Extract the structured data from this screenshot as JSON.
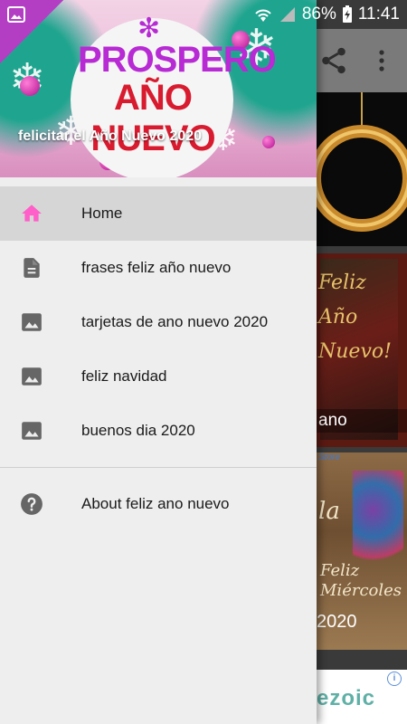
{
  "status_bar": {
    "battery": "86%",
    "time": "11:41"
  },
  "drawer_header": {
    "logo_line1": "PROSPERO",
    "logo_line2": "AÑO NUEVO",
    "caption": "felicitar el Año Nuevo 2020"
  },
  "menu": {
    "items": [
      {
        "label": "Home",
        "icon": "home-icon",
        "active": true
      },
      {
        "label": "frases feliz año nuevo",
        "icon": "document-icon"
      },
      {
        "label": "tarjetas de ano nuevo 2020",
        "icon": "image-icon"
      },
      {
        "label": "feliz navidad",
        "icon": "image-icon"
      },
      {
        "label": "buenos dia 2020",
        "icon": "image-icon"
      }
    ],
    "secondary": [
      {
        "label": "About feliz ano nuevo",
        "icon": "help-icon"
      }
    ]
  },
  "background": {
    "card2_script": "Feliz Año Nuevo!",
    "card2_tail": "ano",
    "card3_store": "Store",
    "card3_script": "la",
    "card3_script2": "Feliz Miércoles",
    "card3_year": "2020",
    "ad_brand": "ezoic",
    "ad_info": "i"
  },
  "colors": {
    "accent_home": "#ff5fc8",
    "icon_gray": "#666666",
    "drawer_bg": "#eeeeee",
    "active_row": "#d6d6d6"
  }
}
